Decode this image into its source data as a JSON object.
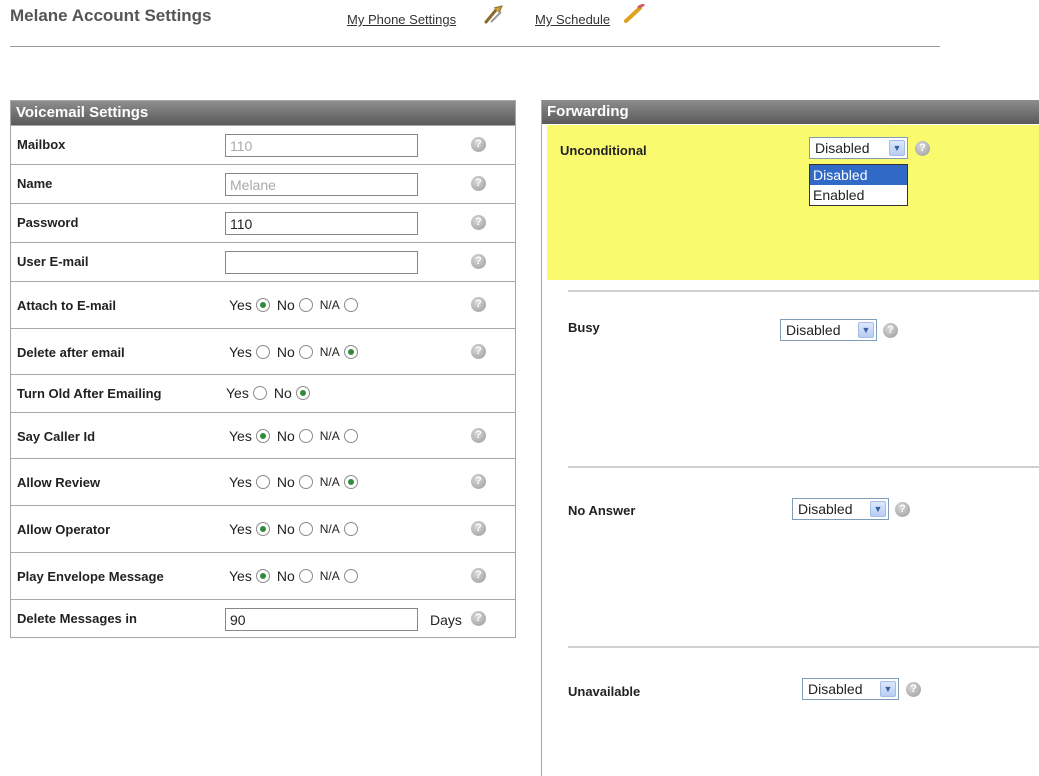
{
  "header": {
    "title": "Melane Account Settings",
    "links": [
      {
        "label": "My Phone Settings",
        "icon": "tools-icon"
      },
      {
        "label": "My Schedule",
        "icon": "pencil-icon"
      }
    ]
  },
  "voicemail": {
    "title": "Voicemail Settings",
    "help_glyph": "?",
    "radio_labels": {
      "yes": "Yes",
      "no": "No",
      "na": "N/A"
    },
    "mailbox": {
      "label": "Mailbox",
      "value": "110"
    },
    "name": {
      "label": "Name",
      "value": "Melane"
    },
    "password": {
      "label": "Password",
      "value": "110"
    },
    "email": {
      "label": "User E-mail",
      "value": ""
    },
    "attach": {
      "label": "Attach to E-mail",
      "selected": "yes"
    },
    "delete_after": {
      "label": "Delete after email",
      "selected": "na"
    },
    "turn_old": {
      "label": "Turn Old After Emailing",
      "selected": "no"
    },
    "say_caller": {
      "label": "Say Caller Id",
      "selected": "yes"
    },
    "allow_review": {
      "label": "Allow Review",
      "selected": "na"
    },
    "allow_operator": {
      "label": "Allow Operator",
      "selected": "yes"
    },
    "play_envelope": {
      "label": "Play Envelope Message",
      "selected": "yes"
    },
    "delete_messages": {
      "label": "Delete Messages in",
      "value": "90",
      "suffix": "Days"
    }
  },
  "forwarding": {
    "title": "Forwarding",
    "highlight_color": "#fafa6e",
    "unconditional": {
      "label": "Unconditional",
      "value": "Disabled",
      "options": [
        "Disabled",
        "Enabled"
      ],
      "open": true
    },
    "busy": {
      "label": "Busy",
      "value": "Disabled"
    },
    "no_answer": {
      "label": "No Answer",
      "value": "Disabled"
    },
    "unavailable": {
      "label": "Unavailable",
      "value": "Disabled"
    }
  }
}
